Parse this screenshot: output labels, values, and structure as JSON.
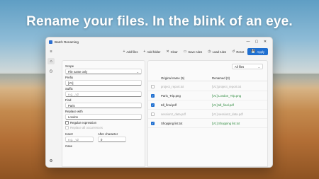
{
  "headline": "Rename your files. In the blink of an eye.",
  "window": {
    "title": "Batch Renaming",
    "controls": [
      "—",
      "▢",
      "✕"
    ]
  },
  "toolbar": [
    {
      "icon": "+",
      "label": "Add files"
    },
    {
      "icon": "+",
      "label": "Add folder"
    },
    {
      "icon": "✕",
      "label": "Clear"
    },
    {
      "icon": "▭",
      "label": "Save rules"
    },
    {
      "icon": "◷",
      "label": "Load rules"
    },
    {
      "icon": "↺",
      "label": "Reset"
    },
    {
      "icon": "💾",
      "label": "Apply"
    }
  ],
  "rules": {
    "scope_label": "Scope",
    "scope_value": "File name only",
    "prefix_label": "Prefix",
    "prefix_value": "[V1]",
    "suffix_label": "Suffix",
    "suffix_placeholder": "e.g. _v2",
    "find_label": "Find",
    "find_value": "Paris",
    "replace_label": "Replace with",
    "replace_value": "London",
    "regex_label": "Regular expression",
    "replace_all_label": "Replace all occurrences",
    "insert_label": "Insert",
    "insert_placeholder": "e.g. _v2",
    "after_label": "After character",
    "after_value": "0",
    "case_label": "Case"
  },
  "files": {
    "filter": "All files",
    "col_original": "Original name (5)",
    "col_renamed": "Renamed (3)",
    "rows": [
      {
        "checked": false,
        "original": "project_report.txt",
        "renamed": "[V1] project_report.txt"
      },
      {
        "checked": true,
        "original": "Paris_Trip.png",
        "renamed": "[V1] London_Trip.png"
      },
      {
        "checked": true,
        "original": "tdl_final.pdf",
        "renamed": "[V1] tdl_final.pdf"
      },
      {
        "checked": false,
        "original": "session2_data.pdf",
        "renamed": "[V1] session2_data.pdf"
      },
      {
        "checked": true,
        "original": "Shopping list.txt",
        "renamed": "[V1] Shopping list.txt"
      }
    ]
  }
}
